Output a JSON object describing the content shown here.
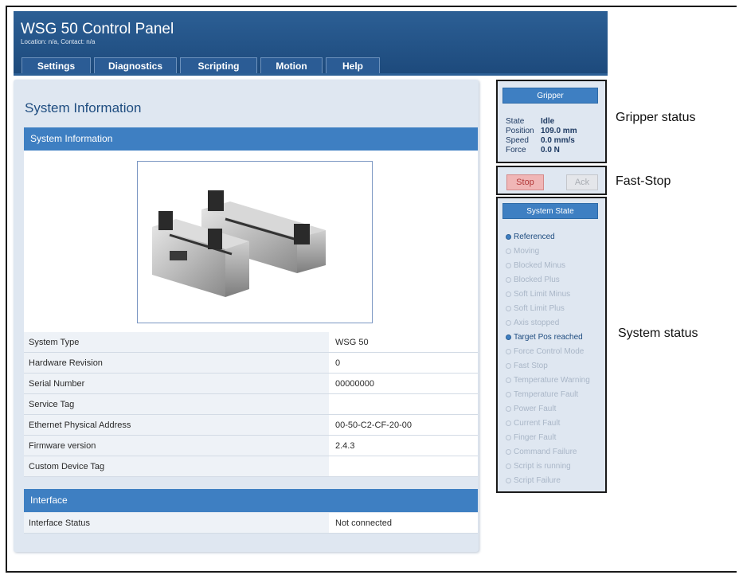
{
  "header": {
    "title": "WSG 50 Control Panel",
    "subtitle": "Location: n/a, Contact: n/a",
    "tabs": [
      "Settings",
      "Diagnostics",
      "Scripting",
      "Motion",
      "Help"
    ]
  },
  "main": {
    "title": "System Information",
    "section_system": "System Information",
    "product_image": "gripper-product-photo",
    "rows": [
      {
        "label": "System Type",
        "value": "WSG 50"
      },
      {
        "label": "Hardware Revision",
        "value": "0"
      },
      {
        "label": "Serial Number",
        "value": "00000000"
      },
      {
        "label": "Service Tag",
        "value": ""
      },
      {
        "label": "Ethernet Physical Address",
        "value": "00-50-C2-CF-20-00"
      },
      {
        "label": "Firmware version",
        "value": "2.4.3"
      },
      {
        "label": "Custom Device Tag",
        "value": ""
      }
    ],
    "section_interface": "Interface",
    "interface_row": {
      "label": "Interface Status",
      "value": "Not connected"
    }
  },
  "gripper": {
    "button": "Gripper",
    "state_label": "State",
    "state_value": "Idle",
    "position_label": "Position",
    "position_value": "109.0 mm",
    "speed_label": "Speed",
    "speed_value": "0.0 mm/s",
    "force_label": "Force",
    "force_value": "0.0 N"
  },
  "faststop": {
    "stop": "Stop",
    "ack": "Ack"
  },
  "system_state": {
    "button": "System State",
    "items": [
      {
        "label": "Referenced",
        "active": true
      },
      {
        "label": "Moving",
        "active": false
      },
      {
        "label": "Blocked Minus",
        "active": false
      },
      {
        "label": "Blocked Plus",
        "active": false
      },
      {
        "label": "Soft Limit Minus",
        "active": false
      },
      {
        "label": "Soft Limit Plus",
        "active": false
      },
      {
        "label": "Axis stopped",
        "active": false
      },
      {
        "label": "Target Pos reached",
        "active": true
      },
      {
        "label": "Force Control Mode",
        "active": false
      },
      {
        "label": "Fast Stop",
        "active": false
      },
      {
        "label": "Temperature Warning",
        "active": false
      },
      {
        "label": "Temperature Fault",
        "active": false
      },
      {
        "label": "Power Fault",
        "active": false
      },
      {
        "label": "Current Fault",
        "active": false
      },
      {
        "label": "Finger Fault",
        "active": false
      },
      {
        "label": "Command Failure",
        "active": false
      },
      {
        "label": "Script is running",
        "active": false
      },
      {
        "label": "Script Failure",
        "active": false
      }
    ]
  },
  "annotations": {
    "gripper": "Gripper status",
    "faststop": "Fast-Stop",
    "system": "System status"
  },
  "colors": {
    "accent": "#3e7fc2",
    "header": "#2c5f95",
    "panel": "#dfe7f1",
    "stop": "#f0b6b6"
  }
}
